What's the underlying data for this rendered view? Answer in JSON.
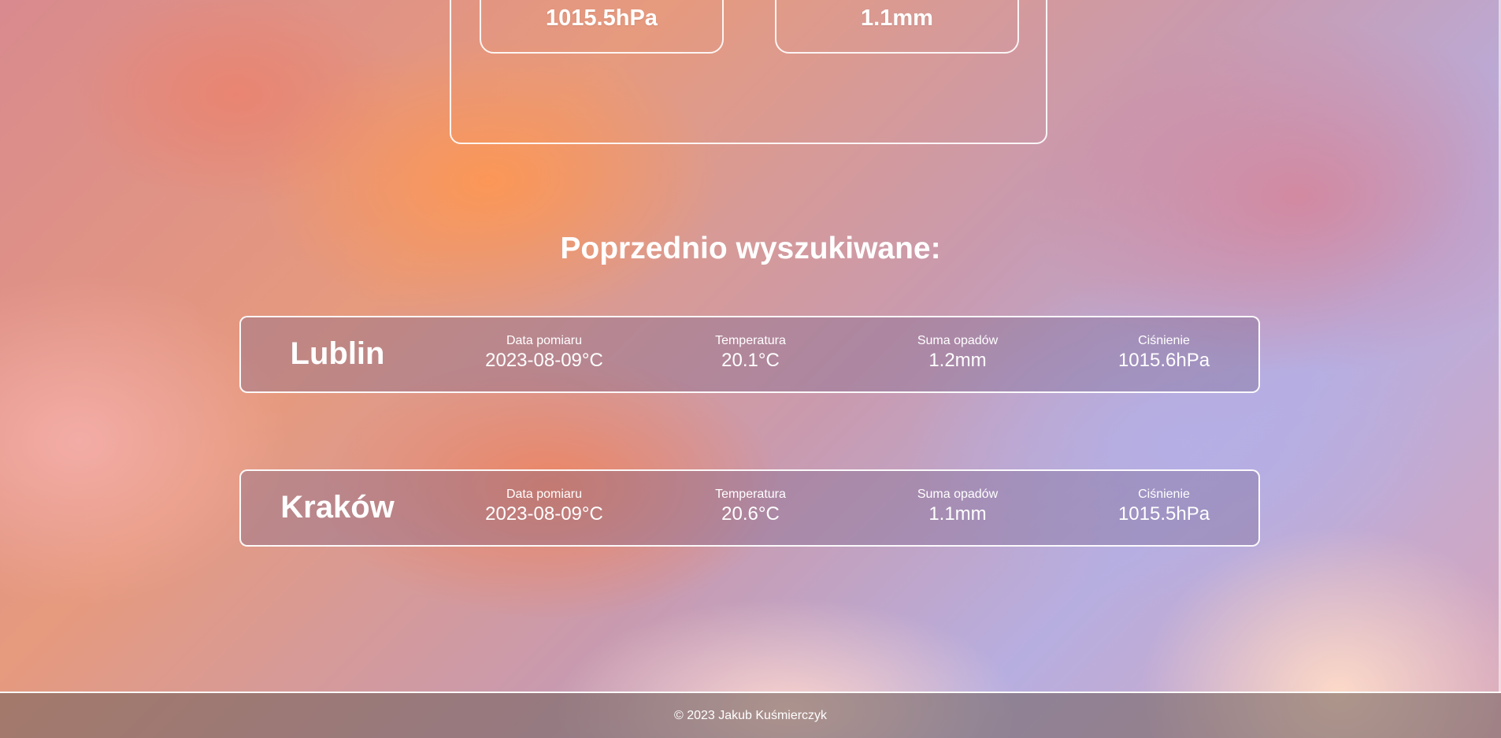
{
  "current": {
    "pressure": "1015.5hPa",
    "rainfall": "1.1mm"
  },
  "history": {
    "title": "Poprzednio wyszukiwane:",
    "labels": {
      "date": "Data pomiaru",
      "temperature": "Temperatura",
      "rainfall": "Suma opadów",
      "pressure": "Ciśnienie"
    },
    "rows": [
      {
        "city": "Lublin",
        "date": "2023-08-09°C",
        "temperature": "20.1°C",
        "rainfall": "1.2mm",
        "pressure": "1015.6hPa"
      },
      {
        "city": "Kraków",
        "date": "2023-08-09°C",
        "temperature": "20.6°C",
        "rainfall": "1.1mm",
        "pressure": "1015.5hPa"
      }
    ]
  },
  "footer": {
    "copyright": "© 2023 Jakub Kuśmierczyk"
  }
}
